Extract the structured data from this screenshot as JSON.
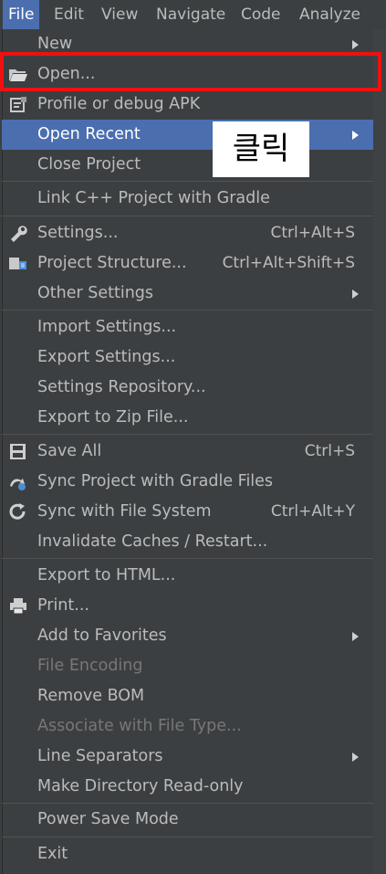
{
  "menubar": {
    "items": [
      {
        "label": "File",
        "active": true
      },
      {
        "label": "Edit"
      },
      {
        "label": "View"
      },
      {
        "label": "Navigate"
      },
      {
        "label": "Code"
      },
      {
        "label": "Analyze"
      }
    ]
  },
  "menu": {
    "items": {
      "new": {
        "label": "New"
      },
      "open": {
        "label": "Open..."
      },
      "profile": {
        "label": "Profile or debug APK"
      },
      "open_recent": {
        "label": "Open Recent"
      },
      "close_project": {
        "label": "Close Project"
      },
      "link_cpp": {
        "label": "Link C++ Project with Gradle"
      },
      "settings": {
        "label": "Settings...",
        "shortcut": "Ctrl+Alt+S"
      },
      "project_structure": {
        "label": "Project Structure...",
        "shortcut": "Ctrl+Alt+Shift+S"
      },
      "other_settings": {
        "label": "Other Settings"
      },
      "import_settings": {
        "label": "Import Settings..."
      },
      "export_settings": {
        "label": "Export Settings..."
      },
      "settings_repo": {
        "label": "Settings Repository..."
      },
      "export_zip": {
        "label": "Export to Zip File..."
      },
      "save_all": {
        "label": "Save All",
        "shortcut": "Ctrl+S"
      },
      "sync_gradle": {
        "label": "Sync Project with Gradle Files"
      },
      "sync_fs": {
        "label": "Sync with File System",
        "shortcut": "Ctrl+Alt+Y"
      },
      "invalidate": {
        "label": "Invalidate Caches / Restart..."
      },
      "export_html": {
        "label": "Export to HTML..."
      },
      "print": {
        "label": "Print..."
      },
      "add_favorites": {
        "label": "Add to Favorites"
      },
      "file_encoding": {
        "label": "File Encoding"
      },
      "remove_bom": {
        "label": "Remove BOM"
      },
      "associate": {
        "label": "Associate with File Type..."
      },
      "line_separators": {
        "label": "Line Separators"
      },
      "make_readonly": {
        "label": "Make Directory Read-only"
      },
      "power_save": {
        "label": "Power Save Mode"
      },
      "exit": {
        "label": "Exit"
      }
    }
  },
  "annotation": {
    "label": "클릭"
  },
  "colors": {
    "menu_bg": "#3c3f41",
    "highlight": "#4b6eaf",
    "text": "#bbbbbb",
    "disabled_text": "#777777",
    "callout_border": "#ee1111"
  }
}
